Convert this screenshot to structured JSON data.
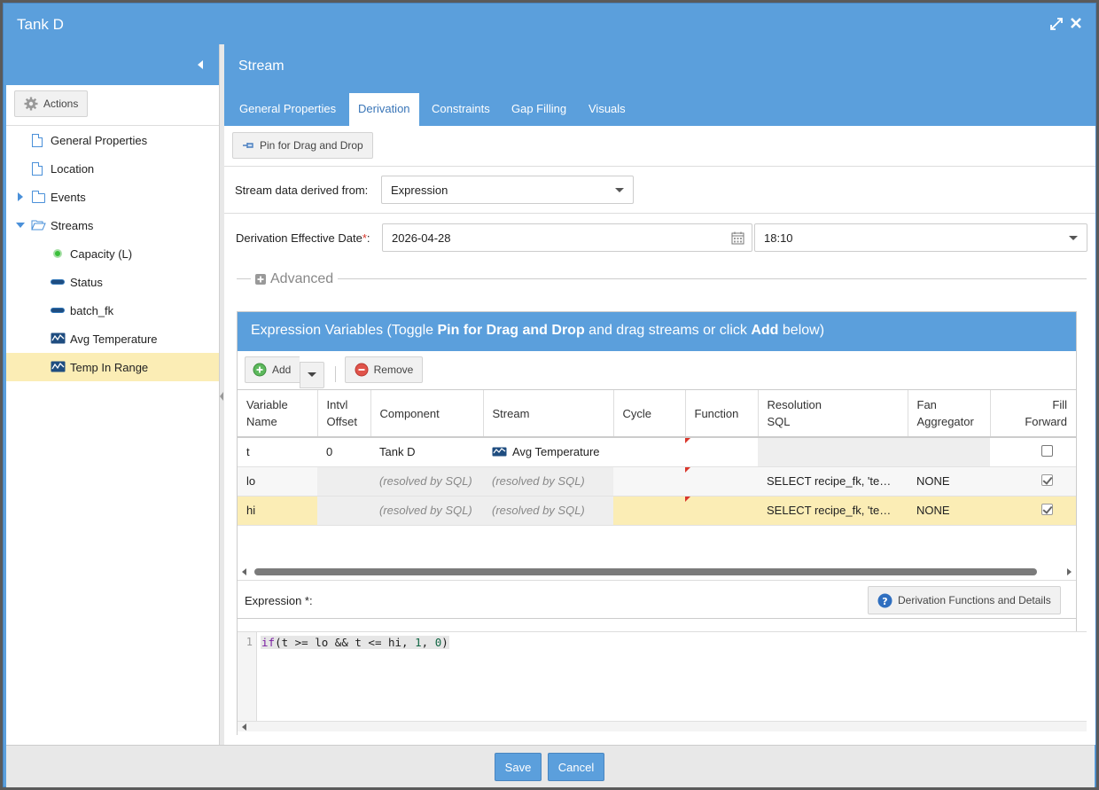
{
  "window": {
    "title": "Tank D"
  },
  "sidebar": {
    "actions_label": "Actions",
    "items": [
      {
        "label": "General Properties",
        "icon": "document-icon"
      },
      {
        "label": "Location",
        "icon": "document-icon"
      },
      {
        "label": "Events",
        "icon": "folder-icon"
      },
      {
        "label": "Streams",
        "icon": "folder-open-icon"
      },
      {
        "label": "Capacity (L)",
        "icon": "green-dot-icon"
      },
      {
        "label": "Status",
        "icon": "pill-icon"
      },
      {
        "label": "batch_fk",
        "icon": "pill-icon"
      },
      {
        "label": "Avg Temperature",
        "icon": "wave-stream-icon"
      },
      {
        "label": "Temp In Range",
        "icon": "wave-stream-icon",
        "selected": true
      }
    ]
  },
  "main": {
    "header": "Stream",
    "tabs": [
      {
        "label": "General Properties"
      },
      {
        "label": "Derivation",
        "active": true
      },
      {
        "label": "Constraints"
      },
      {
        "label": "Gap Filling"
      },
      {
        "label": "Visuals"
      }
    ],
    "pin_label": "Pin for Drag and Drop",
    "derived_from_label": "Stream data derived from:",
    "derived_from_value": "Expression",
    "effective_date_label": "Derivation Effective Date",
    "required_mark": "*",
    "colon": ":",
    "effective_date_value": "2026-04-28",
    "effective_time_value": "18:10",
    "advanced_label": "Advanced"
  },
  "expr_panel": {
    "title_prefix": "Expression Variables (Toggle ",
    "title_pin": "Pin for Drag and Drop",
    "title_mid": " and drag streams or click ",
    "title_add": "Add",
    "title_suffix": " below)",
    "add_label": "Add",
    "remove_label": "Remove",
    "columns": [
      {
        "l1": "Variable",
        "l2": "Name"
      },
      {
        "l1": "Intvl",
        "l2": "Offset"
      },
      {
        "l1": "Component",
        "l2": ""
      },
      {
        "l1": "Stream",
        "l2": ""
      },
      {
        "l1": "Cycle",
        "l2": ""
      },
      {
        "l1": "Function",
        "l2": ""
      },
      {
        "l1": "Resolution",
        "l2": "SQL"
      },
      {
        "l1": "Fan",
        "l2": "Aggregator"
      },
      {
        "l1": "Fill",
        "l2": "Forward"
      }
    ],
    "rows": [
      {
        "name": "t",
        "offset": "0",
        "component": "Tank D",
        "stream": "Avg Temperature",
        "cycle": "",
        "function": "",
        "sql": "",
        "fan": "",
        "fill": false
      },
      {
        "name": "lo",
        "offset": "",
        "component": "(resolved by SQL)",
        "stream": "(resolved by SQL)",
        "cycle": "",
        "function": "",
        "sql": "SELECT recipe_fk, 'te…",
        "fan": "NONE",
        "fill": true
      },
      {
        "name": "hi",
        "offset": "",
        "component": "(resolved by SQL)",
        "stream": "(resolved by SQL)",
        "cycle": "",
        "function": "",
        "sql": "SELECT recipe_fk, 'te…",
        "fan": "NONE",
        "fill": true
      }
    ],
    "expression_label": "Expression *:",
    "functions_label": "Derivation Functions and Details",
    "code_line_number": "1",
    "code": {
      "kw": "if",
      "p1": "(t >= lo && t <= hi, ",
      "n1": "1",
      "p2": ", ",
      "n2": "0",
      "p3": ")"
    }
  },
  "footer": {
    "save_label": "Save",
    "cancel_label": "Cancel"
  }
}
